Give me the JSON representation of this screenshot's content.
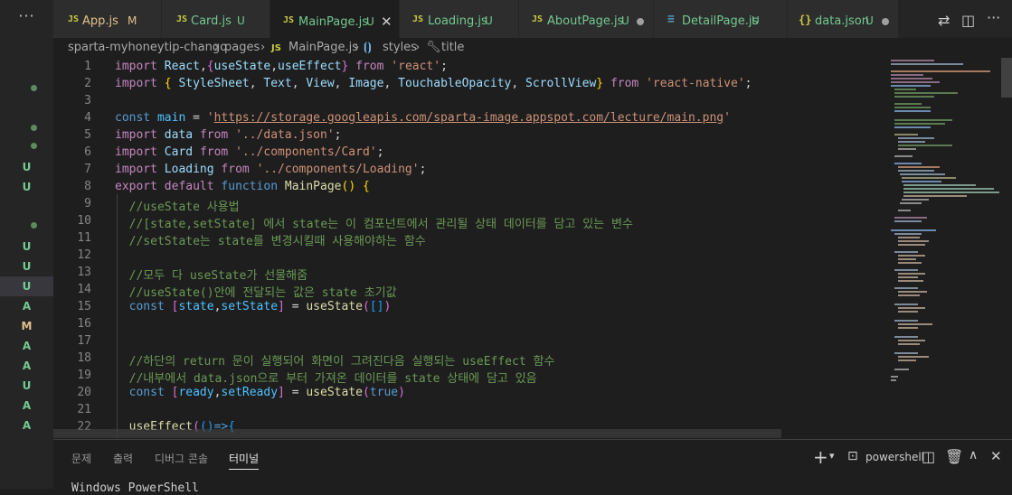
{
  "side": {
    "menu": "···",
    "statuses": [
      "U",
      "U",
      "U",
      "U",
      "U",
      "A",
      "M",
      "A",
      "A",
      "U",
      "A",
      "A"
    ]
  },
  "tabs": [
    {
      "icon": "JS",
      "name": "App.js",
      "badge": "M",
      "badge_color": "#e2c08d",
      "name_color": "#e2c08d",
      "active": false,
      "extra": ""
    },
    {
      "icon": "JS",
      "name": "Card.js",
      "badge": "U",
      "badge_color": "#73c991",
      "name_color": "#73c991",
      "active": false,
      "extra": ""
    },
    {
      "icon": "JS",
      "name": "MainPage.js",
      "badge": "U",
      "badge_color": "#73c991",
      "name_color": "#73c991",
      "active": true,
      "extra": "close"
    },
    {
      "icon": "JS",
      "name": "Loading.js",
      "badge": "U",
      "badge_color": "#73c991",
      "name_color": "#73c991",
      "active": false,
      "extra": ""
    },
    {
      "icon": "JS",
      "name": "AboutPage.js",
      "badge": "U",
      "badge_color": "#73c991",
      "name_color": "#73c991",
      "active": false,
      "extra": "dot"
    },
    {
      "icon": "≡",
      "name": "DetailPage.js",
      "badge": "U",
      "badge_color": "#73c991",
      "name_color": "#73c991",
      "active": false,
      "extra": ""
    },
    {
      "icon": "{}",
      "name": "data.json",
      "badge": "U",
      "badge_color": "#73c991",
      "name_color": "#73c991",
      "active": false,
      "extra": "dot"
    }
  ],
  "breadcrumb": {
    "project": "sparta-myhoneytip-chango",
    "folder": "pages",
    "file": "MainPage.js",
    "symbol1": "styles",
    "symbol2": "title"
  },
  "editor": {
    "line_numbers": [
      "1",
      "2",
      "3",
      "4",
      "5",
      "6",
      "7",
      "8",
      "9",
      "10",
      "11",
      "12",
      "13",
      "14",
      "15",
      "16",
      "17",
      "18",
      "19",
      "20",
      "21",
      "22"
    ]
  },
  "panel": {
    "tabs": [
      "문제",
      "출력",
      "디버그 콘솔",
      "터미널"
    ],
    "active_tab": "터미널",
    "shell": "powershell",
    "terminal_text": "Windows PowerShell"
  },
  "colors": {
    "added": "#73c991",
    "modified": "#e2c08d",
    "accent": "#007acc"
  }
}
